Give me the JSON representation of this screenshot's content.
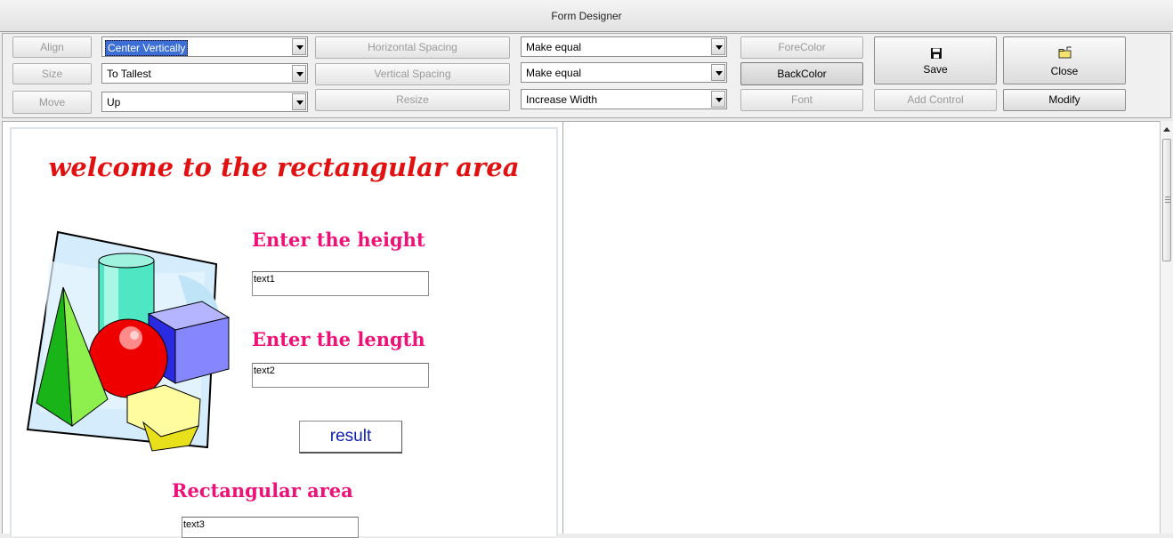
{
  "window": {
    "title": "Form Designer"
  },
  "toolbar": {
    "align_label": "Align",
    "size_label": "Size",
    "move_label": "Move",
    "align_combo": "Center Vertically",
    "size_combo": "To Tallest",
    "move_combo": "Up",
    "hspacing_label": "Horizontal Spacing",
    "vspacing_label": "Vertical Spacing",
    "resize_label": "Resize",
    "hspacing_combo": "Make equal",
    "vspacing_combo": "Make equal",
    "resize_combo": "Increase Width",
    "forecolor_label": "ForeColor",
    "backcolor_label": "BackColor",
    "font_label": "Font",
    "save_label": "Save",
    "close_label": "Close",
    "add_control_label": "Add Control",
    "modify_label": "Modify"
  },
  "form": {
    "headline": "welcome to the rectangular area",
    "height_label": "Enter the height",
    "length_label": "Enter the length",
    "text1": "text1",
    "text2": "text2",
    "result_button": "result",
    "area_label": "Rectangular area",
    "text3": "text3"
  },
  "colors": {
    "headline": "#e21010",
    "labels": "#ee1177",
    "result_text": "#1020b0",
    "selection": "#3b6fd6"
  }
}
